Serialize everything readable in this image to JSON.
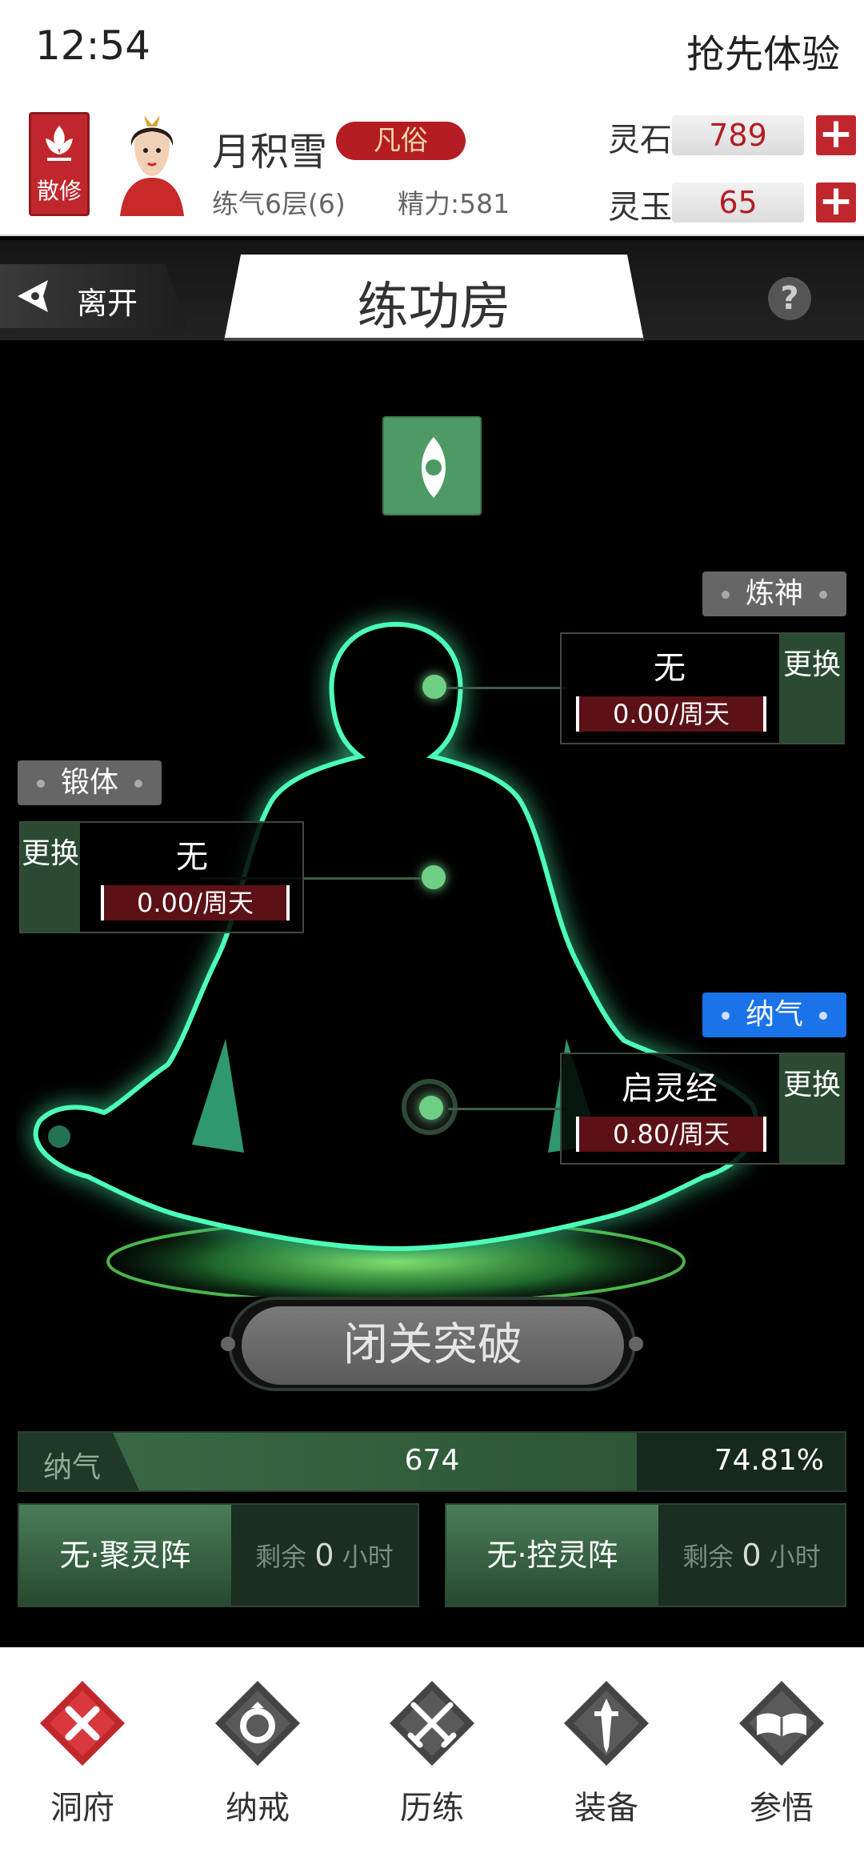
{
  "status": {
    "time": "12:54",
    "trial": "抢先体验"
  },
  "profile": {
    "sect": "散修",
    "name": "月积雪",
    "rank": "凡俗",
    "realm": "练气6层(6)",
    "energy": "精力:581"
  },
  "resources": [
    {
      "label": "灵石",
      "value": "789"
    },
    {
      "label": "灵玉",
      "value": "65"
    }
  ],
  "titlebar": {
    "leave": "离开",
    "title": "练功房",
    "help": "?"
  },
  "slots": {
    "refine_spirit": {
      "tag": "炼神",
      "technique": "无",
      "rate": "0.00/周天",
      "change": "更换"
    },
    "body_temper": {
      "tag": "锻体",
      "technique": "无",
      "rate": "0.00/周天",
      "change": "更换"
    },
    "qi_gather": {
      "tag": "纳气",
      "technique": "启灵经",
      "rate": "0.80/周天",
      "change": "更换"
    }
  },
  "breakthrough": {
    "label": "闭关突破"
  },
  "progress": {
    "label": "纳气",
    "value": "674",
    "percent": "74.81%",
    "fill_fraction": 0.7481
  },
  "arrays": [
    {
      "name": "无·聚灵阵",
      "remain_prefix": "剩余",
      "remain_value": "0",
      "remain_unit": "小时"
    },
    {
      "name": "无·控灵阵",
      "remain_prefix": "剩余",
      "remain_value": "0",
      "remain_unit": "小时"
    }
  ],
  "nav": [
    {
      "label": "洞府",
      "icon": "close-icon"
    },
    {
      "label": "纳戒",
      "icon": "ring-icon"
    },
    {
      "label": "历练",
      "icon": "crossed-swords-icon"
    },
    {
      "label": "装备",
      "icon": "sword-icon"
    },
    {
      "label": "参悟",
      "icon": "book-icon"
    }
  ],
  "colors": {
    "accent_red": "#c0272d",
    "accent_green": "#4e9a64",
    "tag_blue": "#1a73e8"
  }
}
